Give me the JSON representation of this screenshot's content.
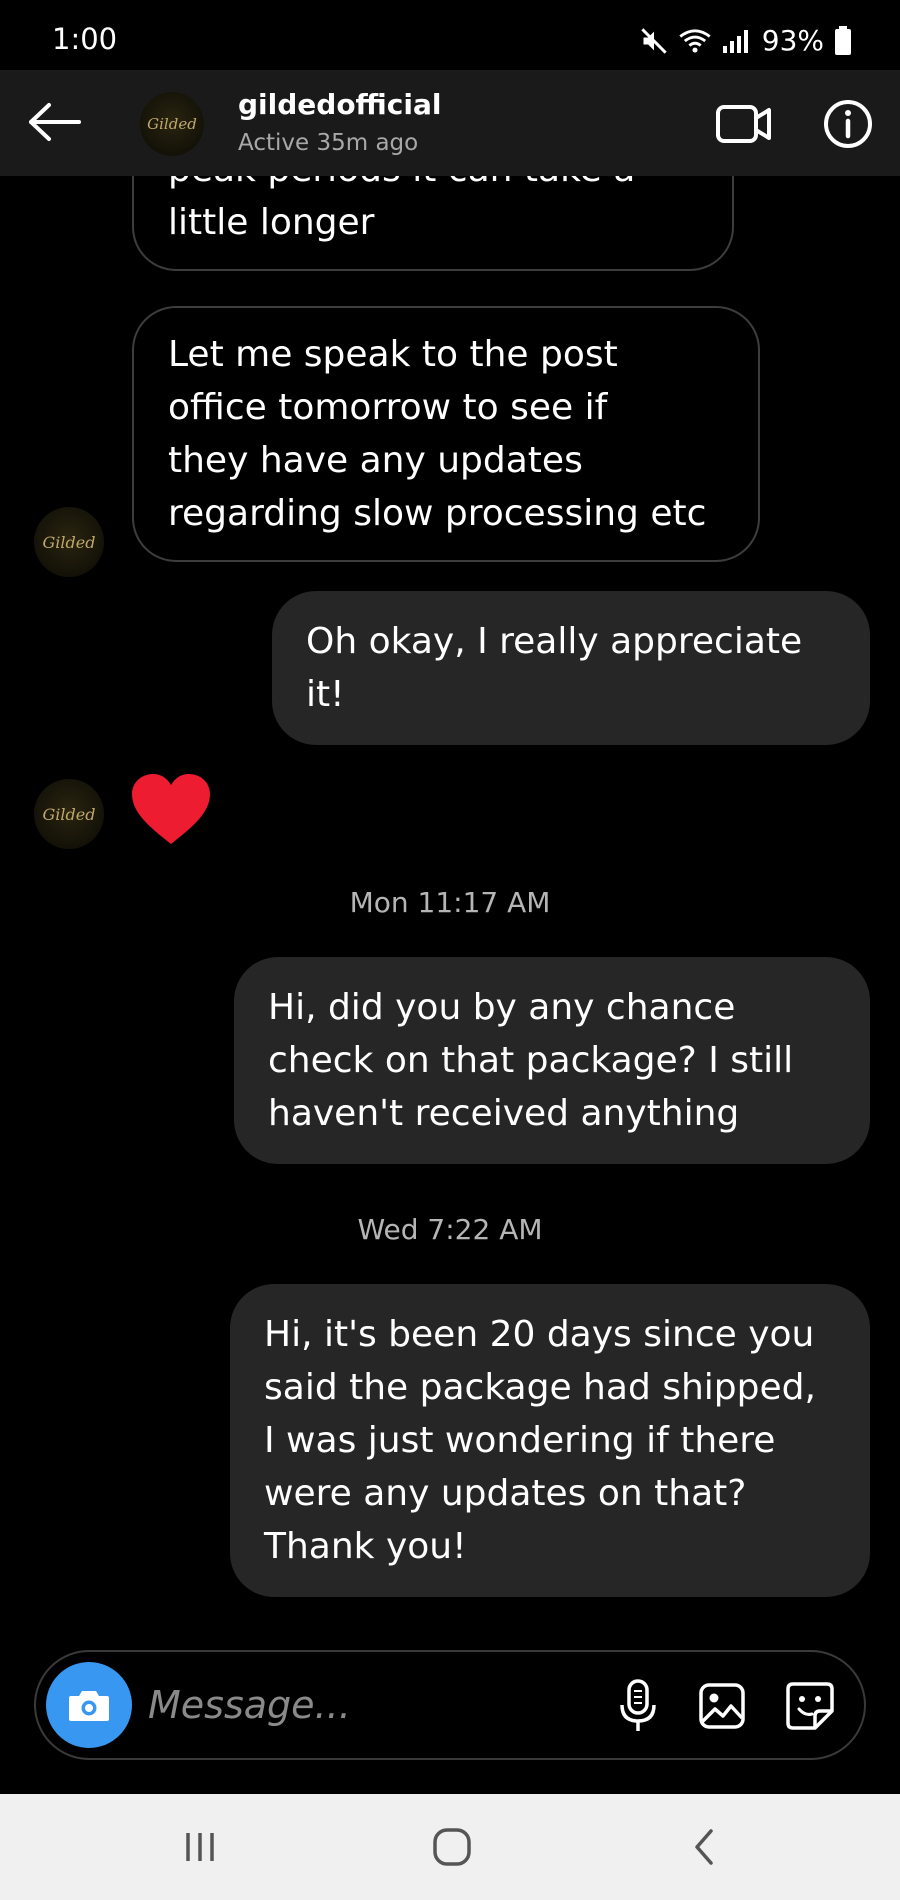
{
  "status_bar": {
    "time": "1:00",
    "battery": "93%"
  },
  "header": {
    "username": "gildedofficial",
    "active_status": "Active 35m ago",
    "avatar_text": "Gilded"
  },
  "messages": [
    {
      "from": "them",
      "text": "peak periods it can take a\nlittle longer"
    },
    {
      "from": "them",
      "text": "Let me speak to the post\noffice tomorrow to see if\nthey have any updates\nregarding slow processing etc"
    },
    {
      "from": "me",
      "text": "Oh okay, I really appreciate\nit!"
    },
    {
      "from": "them",
      "reaction": "heart"
    },
    {
      "timestamp": "Mon 11:17 AM"
    },
    {
      "from": "me",
      "text": "Hi, did you by any chance\ncheck on that package? I still\nhaven't received anything"
    },
    {
      "timestamp": "Wed 7:22 AM"
    },
    {
      "from": "me",
      "text": "Hi, it's been 20 days since you\nsaid the package had shipped,\nI was just wondering if there\nwere any updates on that?\nThank you!"
    }
  ],
  "composer": {
    "placeholder": "Message..."
  },
  "icons": {
    "back": "arrow-left-icon",
    "video": "video-camera-icon",
    "info": "info-icon",
    "camera": "camera-icon",
    "mic": "microphone-icon",
    "gallery": "image-icon",
    "sticker": "sticker-icon"
  },
  "colors": {
    "accent": "#3897f0",
    "heart": "#ed1c30",
    "outgoing_bubble": "#262626"
  }
}
